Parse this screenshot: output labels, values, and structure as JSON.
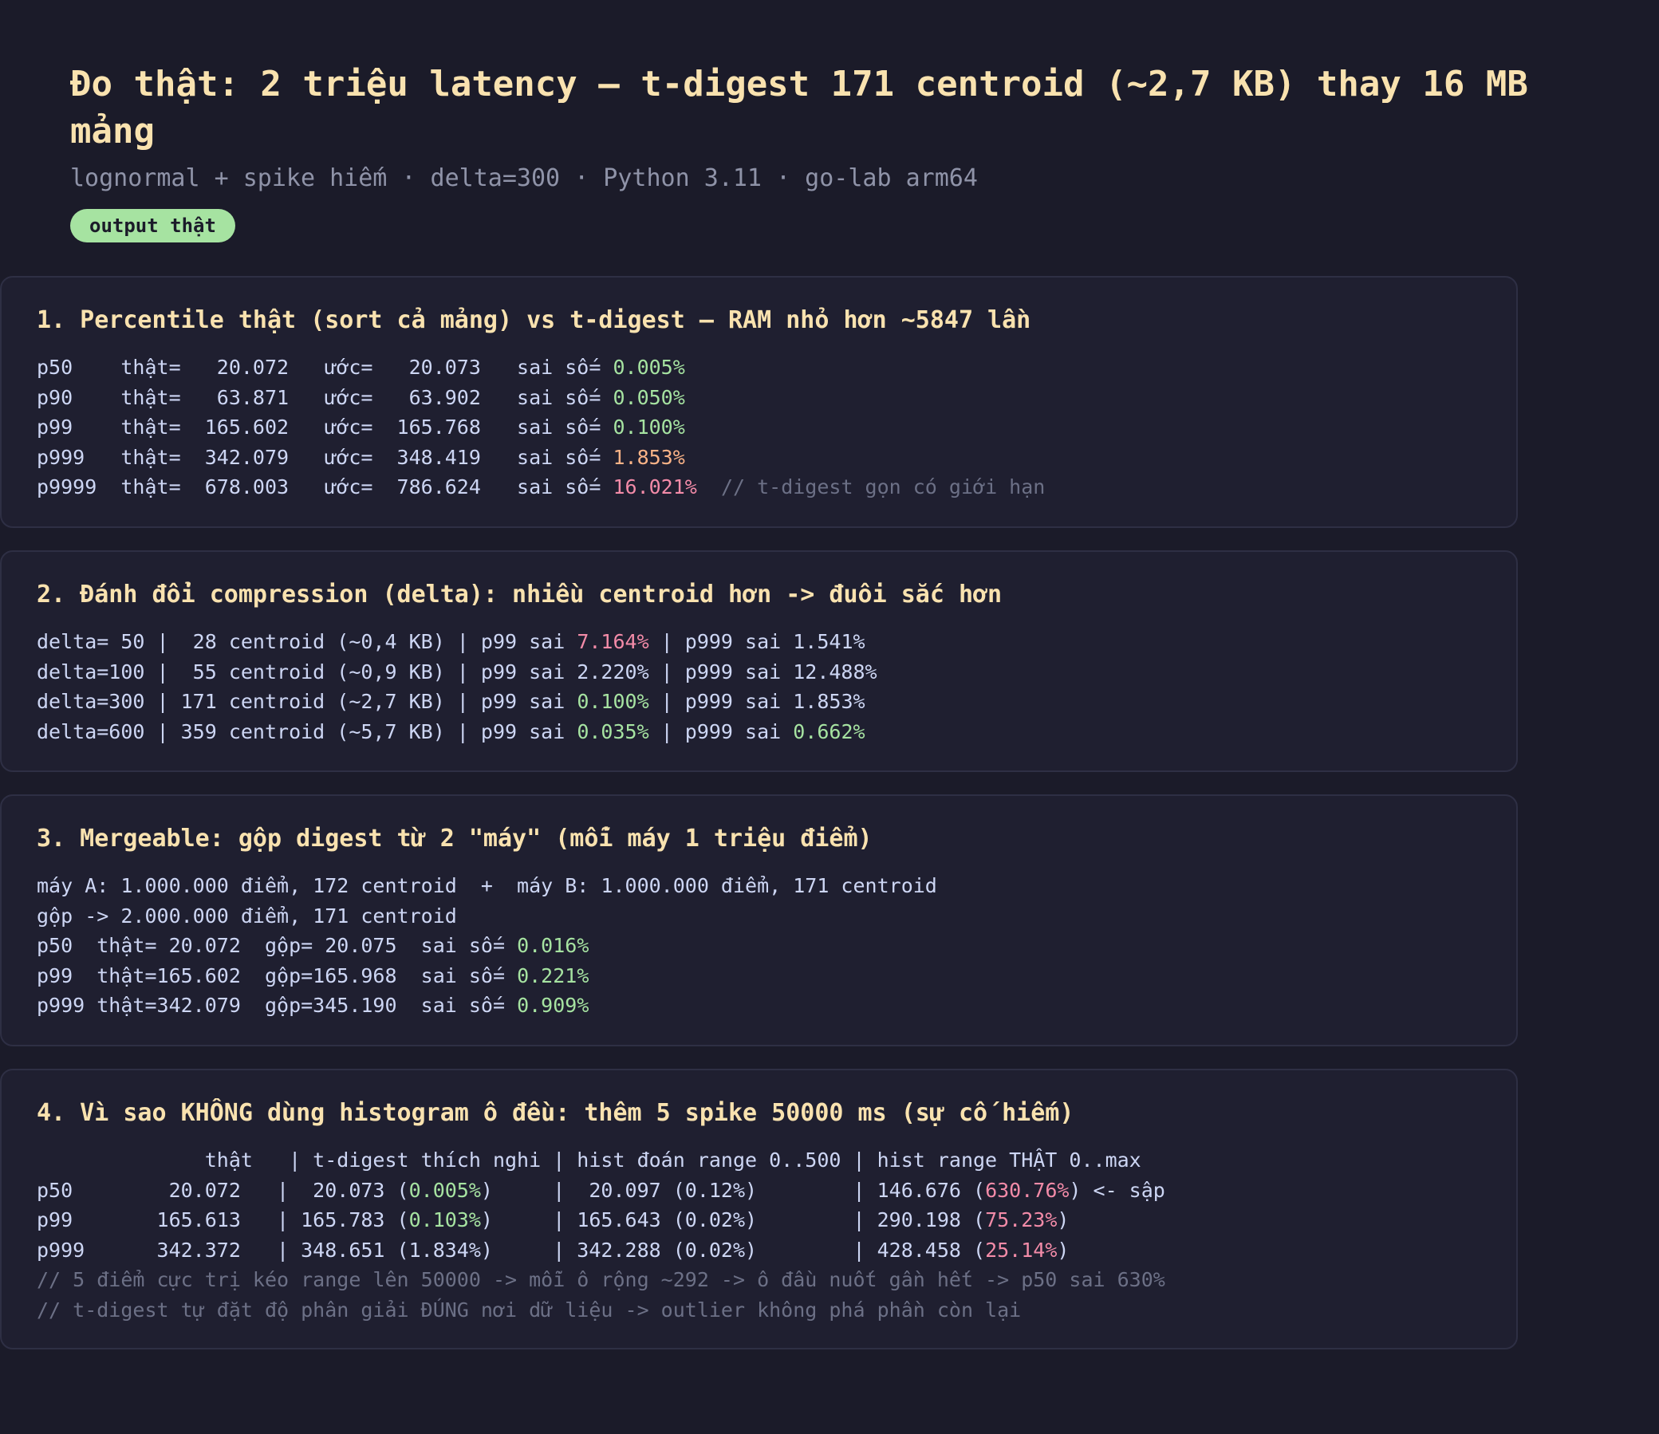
{
  "header": {
    "title": "Đo thật: 2 triệu latency — t-digest 171 centroid (~2,7 KB) thay 16 MB mảng",
    "subtitle": "lognormal + spike hiếm · delta=300 · Python 3.11 · go-lab arm64",
    "badge": "output thật"
  },
  "sections": [
    {
      "title": "1. Percentile thật (sort cả mảng) vs t-digest — RAM nhỏ hơn ~5847 lần",
      "lines": [
        [
          {
            "t": "p50    thật=   20.072   ước=   20.073   sai số= "
          },
          {
            "t": "0.005%",
            "c": "g"
          }
        ],
        [
          {
            "t": "p90    thật=   63.871   ước=   63.902   sai số= "
          },
          {
            "t": "0.050%",
            "c": "g"
          }
        ],
        [
          {
            "t": "p99    thật=  165.602   ước=  165.768   sai số= "
          },
          {
            "t": "0.100%",
            "c": "g"
          }
        ],
        [
          {
            "t": "p999   thật=  342.079   ước=  348.419   sai số= "
          },
          {
            "t": "1.853%",
            "c": "o"
          }
        ],
        [
          {
            "t": "p9999  thật=  678.003   ước=  786.624   sai số= "
          },
          {
            "t": "16.021%",
            "c": "r"
          },
          {
            "t": "  "
          },
          {
            "t": "// t-digest gọn có giới hạn",
            "c": "c"
          }
        ]
      ]
    },
    {
      "title": "2. Đánh đổi compression (delta): nhiều centroid hơn -> đuôi sắc hơn",
      "lines": [
        [
          {
            "t": "delta= 50 |  28 centroid (~0,4 KB) | p99 sai "
          },
          {
            "t": "7.164%",
            "c": "r"
          },
          {
            "t": " | p999 sai 1.541%"
          }
        ],
        [
          {
            "t": "delta=100 |  55 centroid (~0,9 KB) | p99 sai 2.220% | p999 sai 12.488%"
          }
        ],
        [
          {
            "t": "delta=300 | 171 centroid (~2,7 KB) | p99 sai "
          },
          {
            "t": "0.100%",
            "c": "g"
          },
          {
            "t": " | p999 sai 1.853%"
          }
        ],
        [
          {
            "t": "delta=600 | 359 centroid (~5,7 KB) | p99 sai "
          },
          {
            "t": "0.035%",
            "c": "g"
          },
          {
            "t": " | p999 sai "
          },
          {
            "t": "0.662%",
            "c": "g"
          }
        ]
      ]
    },
    {
      "title": "3. Mergeable: gộp digest từ 2 \"máy\" (mỗi máy 1 triệu điểm)",
      "lines": [
        [
          {
            "t": "máy A: 1.000.000 điểm, 172 centroid  +  máy B: 1.000.000 điểm, 171 centroid"
          }
        ],
        [
          {
            "t": "gộp -> 2.000.000 điểm, 171 centroid"
          }
        ],
        [
          {
            "t": "p50  thật= 20.072  gộp= 20.075  sai số= "
          },
          {
            "t": "0.016%",
            "c": "g"
          }
        ],
        [
          {
            "t": "p99  thật=165.602  gộp=165.968  sai số= "
          },
          {
            "t": "0.221%",
            "c": "g"
          }
        ],
        [
          {
            "t": "p999 thật=342.079  gộp=345.190  sai số= "
          },
          {
            "t": "0.909%",
            "c": "g"
          }
        ]
      ]
    },
    {
      "title": "4. Vì sao KHÔNG dùng histogram ô đều: thêm 5 spike 50000 ms (sự cố hiếm)",
      "lines": [
        [
          {
            "t": "              thật   | t-digest thích nghi | hist đoán range 0..500 | hist range THẬT 0..max"
          }
        ],
        [
          {
            "t": "p50        20.072   |  20.073 ("
          },
          {
            "t": "0.005%",
            "c": "g"
          },
          {
            "t": ")     |  20.097 (0.12%)        | 146.676 ("
          },
          {
            "t": "630.76%",
            "c": "r"
          },
          {
            "t": ") <- sập"
          }
        ],
        [
          {
            "t": "p99       165.613   | 165.783 ("
          },
          {
            "t": "0.103%",
            "c": "g"
          },
          {
            "t": ")     | 165.643 (0.02%)        | 290.198 ("
          },
          {
            "t": "75.23%",
            "c": "r"
          },
          {
            "t": ")"
          }
        ],
        [
          {
            "t": "p999      342.372   | 348.651 (1.834%)     | 342.288 (0.02%)        | 428.458 ("
          },
          {
            "t": "25.14%",
            "c": "r"
          },
          {
            "t": ")"
          }
        ],
        [
          {
            "t": "// 5 điểm cực trị kéo range lên 50000 -> mỗi ô rộng ~292 -> ô đầu nuốt gần hết -> p50 sai 630%",
            "c": "c"
          }
        ],
        [
          {
            "t": "// t-digest tự đặt độ phân giải ĐÚNG nơi dữ liệu -> outlier không phá phần còn lại",
            "c": "c"
          }
        ]
      ]
    }
  ]
}
